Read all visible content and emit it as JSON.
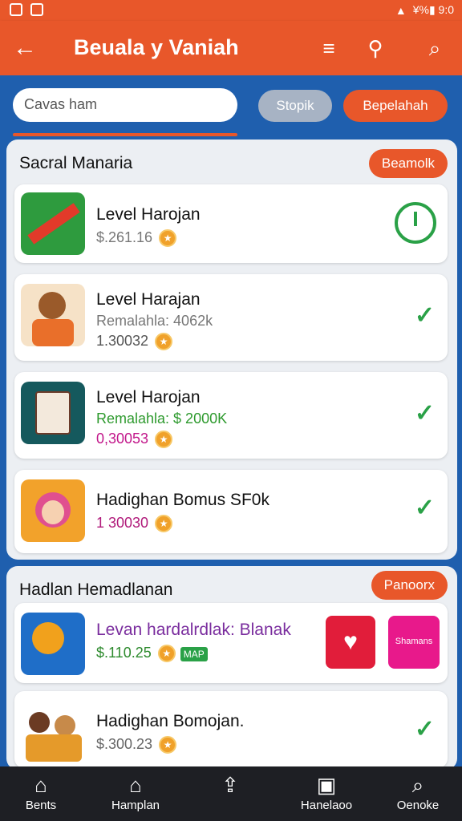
{
  "status": {
    "right_text": "¥%▮ 9:0"
  },
  "appbar": {
    "title": "Beuala y Vaniah"
  },
  "search": {
    "placeholder": "Cavas ham"
  },
  "pills": {
    "left": "Stopik",
    "right": "Bepelahah"
  },
  "section1": {
    "title": "Sacral Manaria",
    "pill": "Beamolk",
    "items": [
      {
        "name": "Level Harojan",
        "line1": "$.261.16",
        "line2": ""
      },
      {
        "name": "Level Harajan",
        "line1": "Remalahla: 4062k",
        "line2": "1.30032"
      },
      {
        "name": "Level Harojan",
        "line1": "Remalahla: $ 2000K",
        "line2": "0,30053"
      },
      {
        "name": "Hadighan Bomus SF0k",
        "line1": "1 30030",
        "line2": ""
      }
    ]
  },
  "section2": {
    "title": "Hadlan Hemadlanan",
    "pill": "Panoorx",
    "items": [
      {
        "name": "Levan hardalrdlak: Blanak",
        "line1": "$.110.25",
        "badge": "MAP",
        "tile2": "Shamans"
      },
      {
        "name": "Hadighan Bomojan.",
        "line1": "$.300.23"
      }
    ]
  },
  "nav": [
    {
      "label": "Bents",
      "icon": "home-icon"
    },
    {
      "label": "Hamplan",
      "icon": "house-outline-icon"
    },
    {
      "label": "",
      "icon": "share-icon"
    },
    {
      "label": "Hanelaoo",
      "icon": "tile-icon"
    },
    {
      "label": "Oenoke",
      "icon": "search-icon"
    }
  ]
}
